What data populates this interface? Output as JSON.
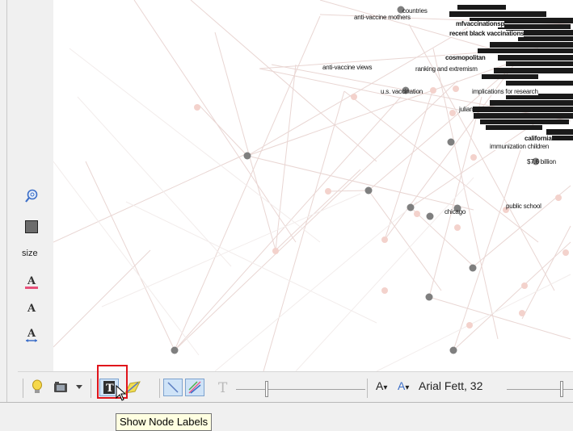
{
  "graph": {
    "labels": [
      {
        "text": "countries",
        "bold": false
      },
      {
        "text": "anti-vaccine mothers",
        "bold": false
      },
      {
        "text": "anti-vaccine views",
        "bold": false
      },
      {
        "text": "ranking and extremism",
        "bold": false
      },
      {
        "text": "u.s. vaccination",
        "bold": false
      },
      {
        "text": "cosmopolitan",
        "bold": true
      },
      {
        "text": "recent black vaccinations",
        "bold": true
      },
      {
        "text": "mfvaccinationsp",
        "bold": true
      },
      {
        "text": "implications for research",
        "bold": false
      },
      {
        "text": "julian",
        "bold": false
      },
      {
        "text": "chicago",
        "bold": false
      },
      {
        "text": "public school",
        "bold": false
      },
      {
        "text": "immunization children",
        "bold": false
      },
      {
        "text": "$7.6 billion",
        "bold": false
      },
      {
        "text": "california",
        "bold": true
      }
    ]
  },
  "side_tools": {
    "size_label": "size"
  },
  "toolbar": {
    "font_name": "Arial Fett, 32"
  },
  "tooltip": {
    "text": "Show Node Labels"
  },
  "colors": {
    "edge": "#e9d6d3",
    "node_gray": "#7f7f7f",
    "node_pink": "#f3d2cc",
    "highlight": "#e0141b",
    "tooltip_bg": "#ffffe1"
  }
}
